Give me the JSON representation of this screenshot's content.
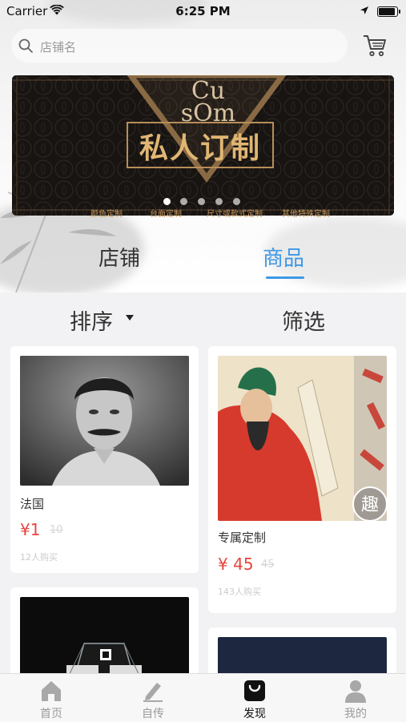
{
  "status_bar": {
    "carrier": "Carrier",
    "time": "6:25 PM",
    "battery_level": 0.92
  },
  "search": {
    "placeholder": "店铺名"
  },
  "banner": {
    "title": "私人订制",
    "decor_text": [
      "Cu",
      "sOm"
    ],
    "labels": [
      "颜色定制",
      "台面定制",
      "尺寸或款式定制",
      "其他特殊定制"
    ],
    "page_count": 5,
    "active_page": 1
  },
  "tabs": [
    {
      "label": "店铺",
      "active": false
    },
    {
      "label": "商品",
      "active": true
    }
  ],
  "filters": {
    "sort_label": "排序",
    "filter_label": "筛选"
  },
  "products": [
    {
      "name": "法国",
      "currency": "¥",
      "price": "1",
      "original_price": "10",
      "sold": "12人购买"
    },
    {
      "name": "专属定制",
      "currency": "¥",
      "price": "45",
      "original_price": "45",
      "sold": "143人购买",
      "badge": "趣"
    },
    {
      "name": "",
      "price": "",
      "original_price": "",
      "sold": ""
    },
    {
      "name": "",
      "price": "",
      "original_price": "",
      "sold": ""
    }
  ],
  "tabbar": [
    {
      "label": "首页",
      "icon": "home-icon",
      "active": false
    },
    {
      "label": "自传",
      "icon": "pen-icon",
      "active": false
    },
    {
      "label": "发现",
      "icon": "shopping-bag-icon",
      "active": true
    },
    {
      "label": "我的",
      "icon": "user-icon",
      "active": false
    }
  ],
  "colors": {
    "accent": "#3e98e6",
    "price": "#e5453e",
    "banner_gold": "#e0b673"
  }
}
